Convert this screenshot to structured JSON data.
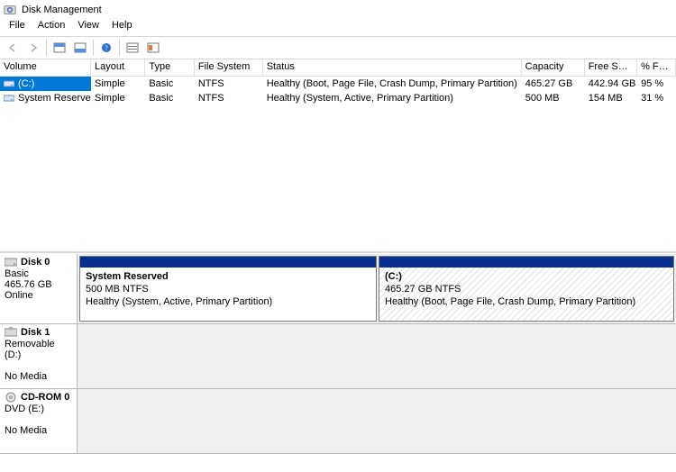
{
  "window": {
    "title": "Disk Management"
  },
  "menu": {
    "file": "File",
    "action": "Action",
    "view": "View",
    "help": "Help"
  },
  "toolbar": {
    "back": "Back",
    "forward": "Forward",
    "refresh": "Refresh",
    "properties": "Properties",
    "help": "Help",
    "view_top": "View Top",
    "view_bottom": "View Bottom"
  },
  "columns": {
    "volume": "Volume",
    "layout": "Layout",
    "type": "Type",
    "filesystem": "File System",
    "status": "Status",
    "capacity": "Capacity",
    "freespace": "Free Spa...",
    "percentfree": "% Free"
  },
  "volumes": [
    {
      "name": "(C:)",
      "layout": "Simple",
      "type": "Basic",
      "filesystem": "NTFS",
      "status": "Healthy (Boot, Page File, Crash Dump, Primary Partition)",
      "capacity": "465.27 GB",
      "freespace": "442.94 GB",
      "percentfree": "95 %",
      "selected": true
    },
    {
      "name": "System Reserved",
      "layout": "Simple",
      "type": "Basic",
      "filesystem": "NTFS",
      "status": "Healthy (System, Active, Primary Partition)",
      "capacity": "500 MB",
      "freespace": "154 MB",
      "percentfree": "31 %",
      "selected": false
    }
  ],
  "disks": {
    "disk0": {
      "name": "Disk 0",
      "subtype": "Basic",
      "size": "465.76 GB",
      "state": "Online",
      "parts": {
        "sysres": {
          "title": "System Reserved",
          "line2": "500 MB NTFS",
          "line3": "Healthy (System, Active, Primary Partition)"
        },
        "c": {
          "title": "(C:)",
          "line2": "465.27 GB NTFS",
          "line3": "Healthy (Boot, Page File, Crash Dump, Primary Partition)"
        }
      }
    },
    "disk1": {
      "name": "Disk 1",
      "subtype": "Removable (D:)",
      "state": "No Media"
    },
    "cdrom0": {
      "name": "CD-ROM 0",
      "subtype": "DVD (E:)",
      "state": "No Media"
    }
  }
}
